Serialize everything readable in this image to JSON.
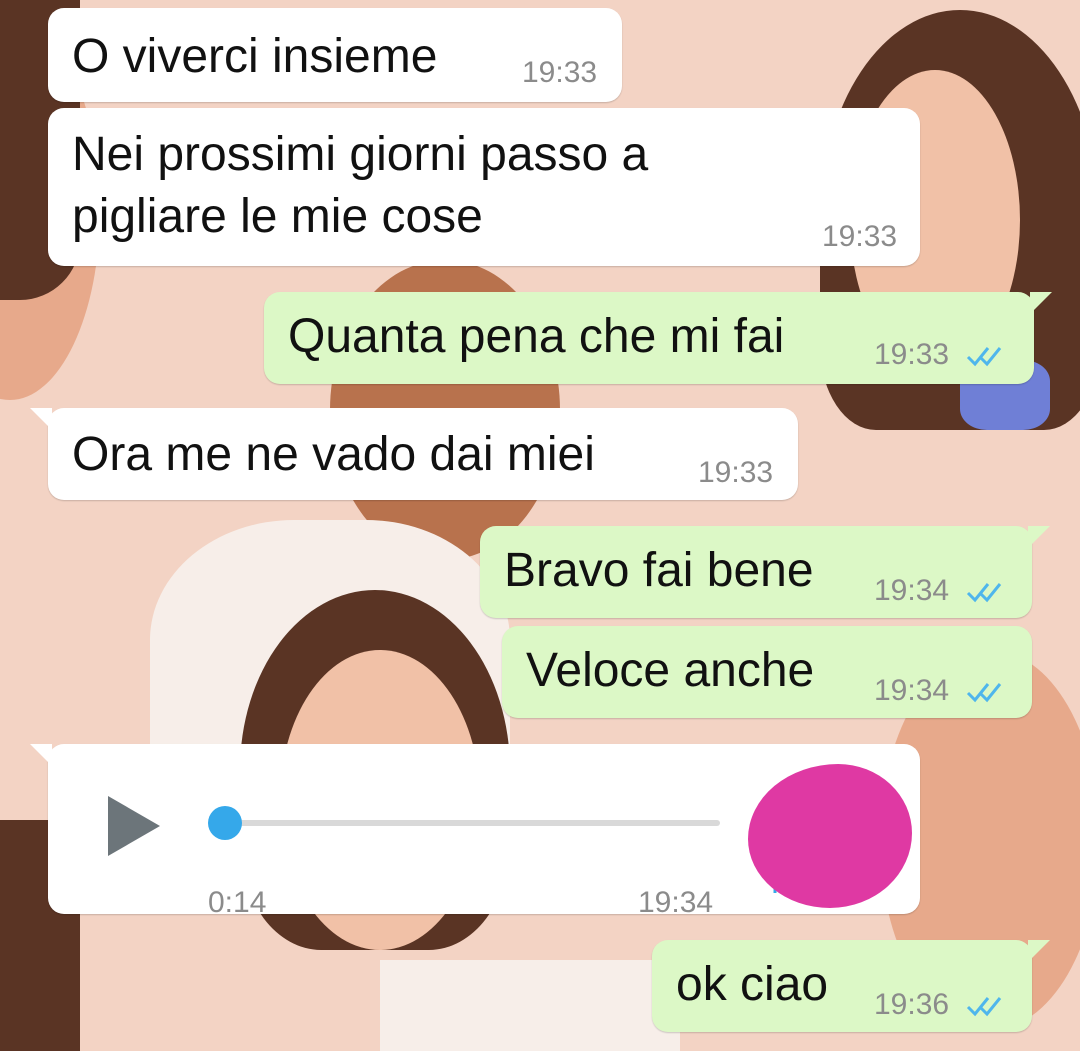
{
  "colors": {
    "incoming_bubble": "#ffffff",
    "outgoing_bubble": "#dcf8c6",
    "read_ticks": "#4fb6ec",
    "audio_progress": "#35a8ea",
    "avatar_redaction": "#df39a3"
  },
  "messages": [
    {
      "direction": "incoming",
      "text": "O viverci insieme",
      "time": "19:33"
    },
    {
      "direction": "incoming",
      "text": "Nei prossimi giorni passo a\npigliare le mie cose",
      "time": "19:33"
    },
    {
      "direction": "outgoing",
      "text": "Quanta pena che mi fai",
      "time": "19:33",
      "status": "read"
    },
    {
      "direction": "incoming",
      "text": "Ora me ne vado dai miei",
      "time": "19:33"
    },
    {
      "direction": "outgoing",
      "text": "Bravo fai bene",
      "time": "19:34",
      "status": "read"
    },
    {
      "direction": "outgoing",
      "text": "Veloce anche",
      "time": "19:34",
      "status": "read"
    },
    {
      "direction": "outgoing",
      "text": "ok ciao",
      "time": "19:36",
      "status": "read"
    }
  ],
  "voice_note": {
    "direction": "incoming",
    "duration": "0:14",
    "time": "19:34",
    "progress": 0,
    "icons": [
      "play-icon",
      "mic-icon"
    ]
  }
}
